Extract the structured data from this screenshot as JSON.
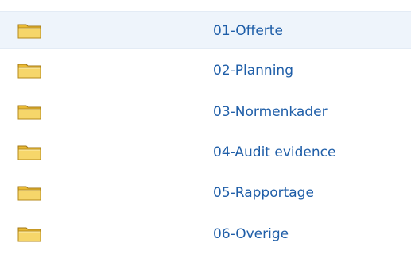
{
  "folders": [
    {
      "name": "01-Offerte",
      "icon": "folder-icon"
    },
    {
      "name": "02-Planning",
      "icon": "folder-icon"
    },
    {
      "name": "03-Normenkader",
      "icon": "folder-icon"
    },
    {
      "name": "04-Audit evidence",
      "icon": "folder-icon"
    },
    {
      "name": "05-Rapportage",
      "icon": "folder-icon"
    },
    {
      "name": "06-Overige",
      "icon": "folder-icon"
    }
  ],
  "colors": {
    "link": "#1f5ea8",
    "selected_row": "#eef4fb",
    "folder_fill": "#f3cc5a",
    "folder_outline": "#b58a1b"
  }
}
